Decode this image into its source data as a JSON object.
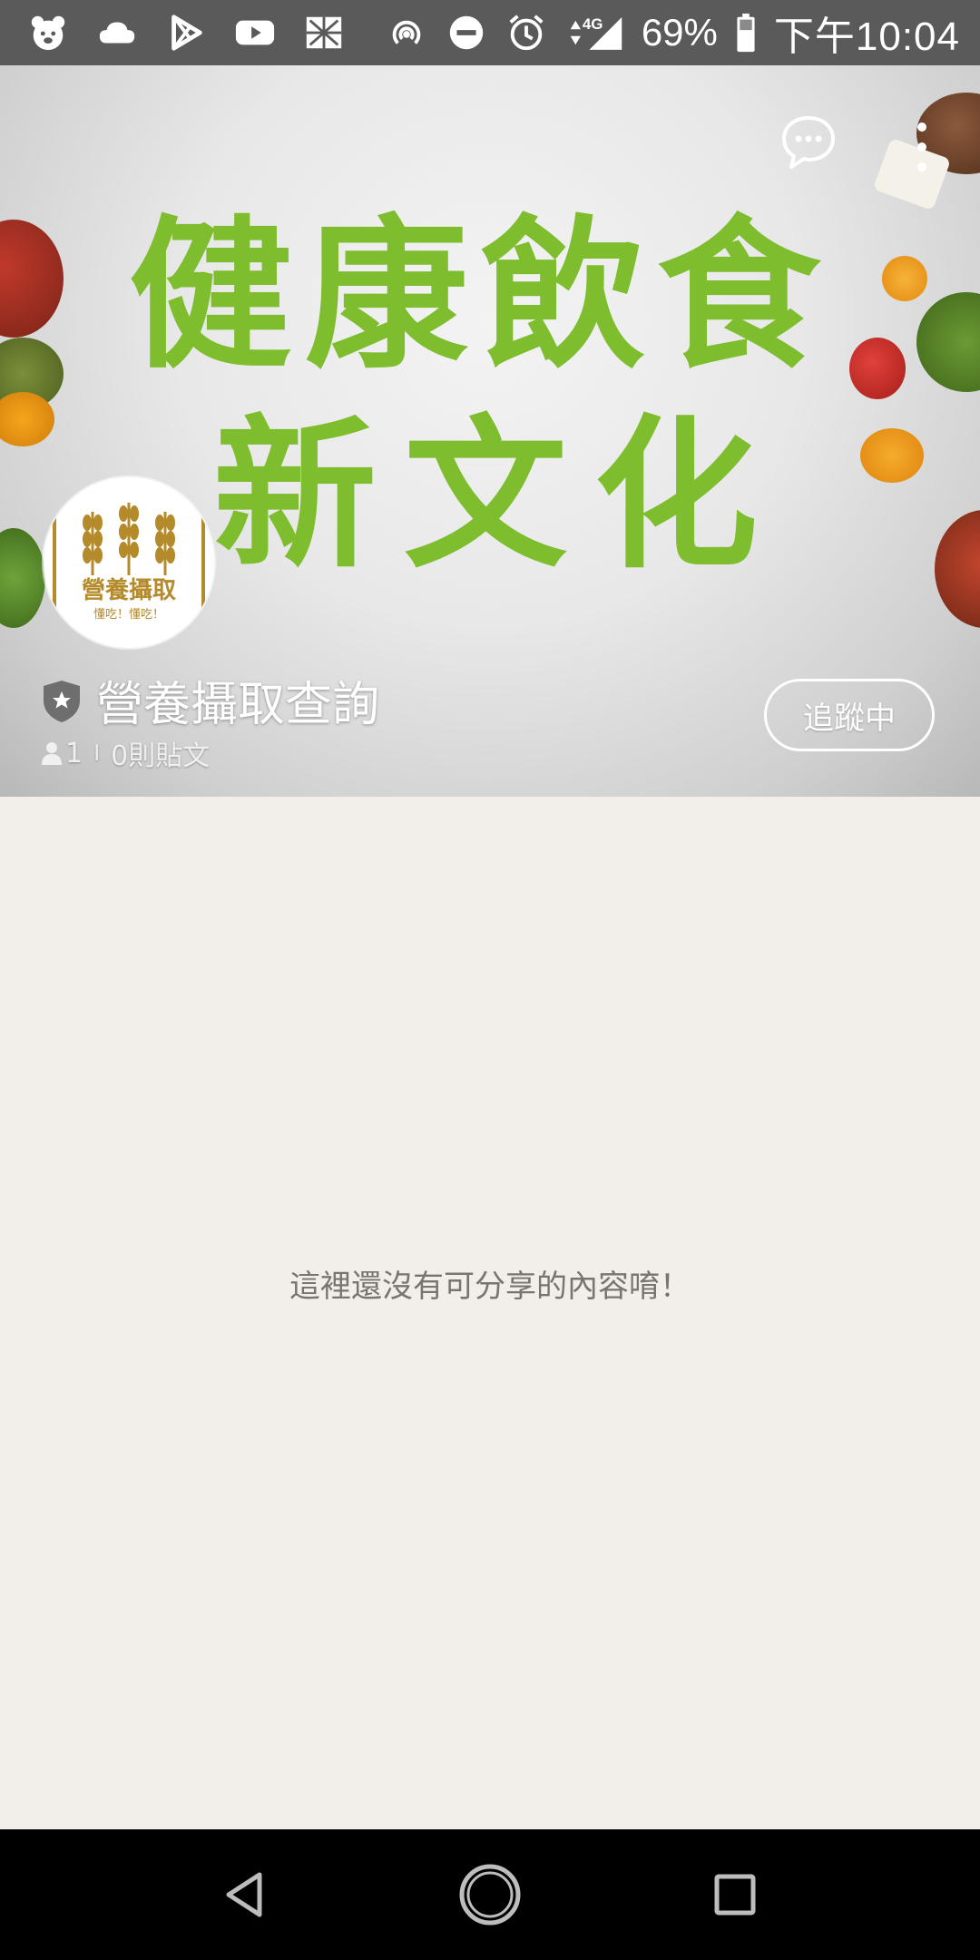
{
  "status_bar": {
    "battery_percent": "69%",
    "time": "下午10:04",
    "network": "4G",
    "icons_left": [
      "bear-icon",
      "cloud-icon",
      "play-store-icon",
      "youtube-icon",
      "gallery-icon"
    ],
    "icons_right": [
      "hotspot-icon",
      "dnd-icon",
      "alarm-icon",
      "signal-icon",
      "battery-icon"
    ]
  },
  "cover": {
    "banner_line1": "健康飲食",
    "banner_line2": "新文化",
    "accent_color": "#7ebd2e"
  },
  "page": {
    "avatar_title": "營養攝取",
    "avatar_subtitle": "懂吃！懂吃！",
    "name": "營養攝取查詢",
    "followers": "1",
    "separator": "I",
    "posts": "0則貼文",
    "follow_label": "追蹤中"
  },
  "content": {
    "empty_message": "這裡還沒有可分享的內容唷！"
  },
  "nav": {
    "buttons": [
      "back-icon",
      "home-icon",
      "recents-icon"
    ]
  }
}
